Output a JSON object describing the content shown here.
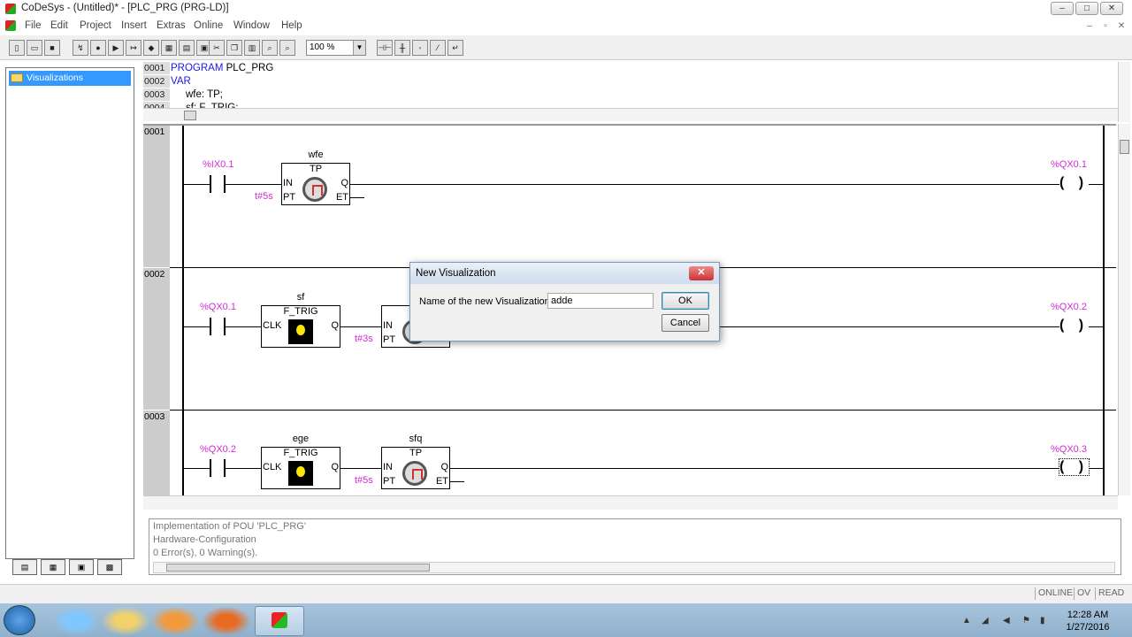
{
  "window": {
    "title": "CoDeSys - (Untitled)* - [PLC_PRG (PRG-LD)]"
  },
  "menu": [
    "File",
    "Edit",
    "Project",
    "Insert",
    "Extras",
    "Online",
    "Window",
    "Help"
  ],
  "toolbar": {
    "zoom": "100 %"
  },
  "tree": {
    "selected": "Visualizations"
  },
  "declaration": {
    "lines": [
      {
        "num": "0001",
        "text": "PROGRAM PLC_PRG"
      },
      {
        "num": "0002",
        "text": "VAR"
      },
      {
        "num": "0003",
        "text": "wfe: TP;"
      },
      {
        "num": "0004",
        "text": "sf: F_TRIG;"
      }
    ]
  },
  "networks": [
    {
      "num": "0001",
      "contact": "%IX0.1",
      "coil": "%QX0.1",
      "blocks": [
        {
          "instance": "wfe",
          "type": "TP",
          "pins_in": [
            "IN",
            "PT"
          ],
          "pins_out": [
            "Q",
            "ET"
          ],
          "pt": "t#5s"
        }
      ]
    },
    {
      "num": "0002",
      "contact": "%QX0.1",
      "coil": "%QX0.2",
      "blocks": [
        {
          "instance": "sf",
          "type": "F_TRIG",
          "pins_in": [
            "CLK"
          ],
          "pins_out": [
            "Q"
          ]
        },
        {
          "instance": "",
          "type": "",
          "pins_in": [
            "IN",
            "PT"
          ],
          "pt": "t#3s"
        }
      ]
    },
    {
      "num": "0003",
      "contact": "%QX0.2",
      "coil": "%QX0.3",
      "blocks": [
        {
          "instance": "ege",
          "type": "F_TRIG",
          "pins_in": [
            "CLK"
          ],
          "pins_out": [
            "Q"
          ]
        },
        {
          "instance": "sfq",
          "type": "TP",
          "pins_in": [
            "IN",
            "PT"
          ],
          "pins_out": [
            "Q",
            "ET"
          ],
          "pt": "t#5s"
        }
      ]
    }
  ],
  "coil_symbol": "( )",
  "output": [
    "Implementation of POU 'PLC_PRG'",
    "Hardware-Configuration",
    "0 Error(s), 0 Warning(s)."
  ],
  "status": [
    "ONLINE",
    "OV",
    "READ"
  ],
  "dialog": {
    "title": "New Visualization",
    "label": "Name of the new Visualization:",
    "value": "adde",
    "ok": "OK",
    "cancel": "Cancel"
  },
  "clock": {
    "time": "12:28 AM",
    "date": "1/27/2016"
  }
}
